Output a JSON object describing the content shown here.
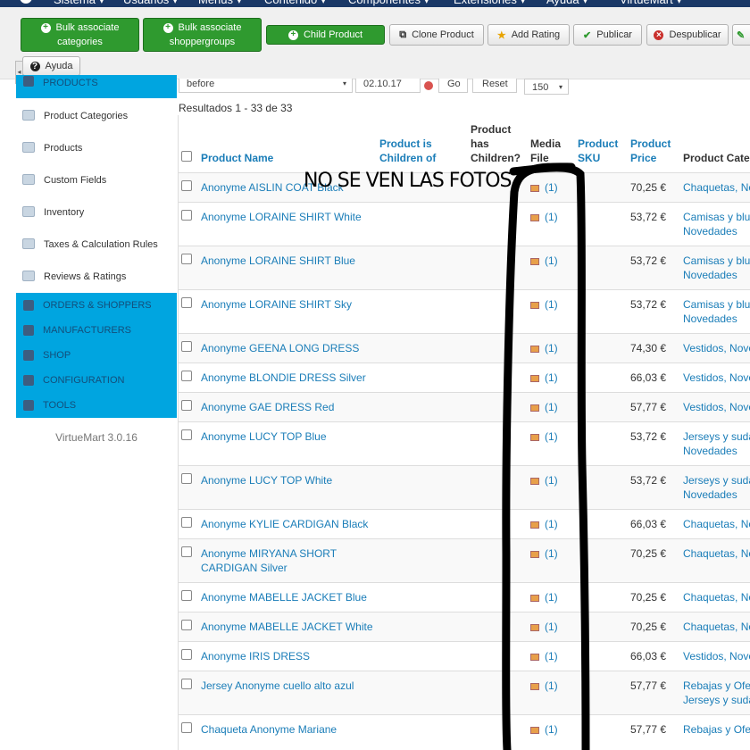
{
  "top_menu": [
    "Sistema ▾",
    "Usuarios ▾",
    "Menús ▾",
    "Contenido ▾",
    "Componentes ▾",
    "Extensiones ▾",
    "Ayuda ▾",
    "VirtueMart ▾"
  ],
  "toolbar": {
    "bulk_categories": [
      "Bulk associate",
      "categories"
    ],
    "bulk_shoppergroups": [
      "Bulk associate",
      "shoppergroups"
    ],
    "child_product": "Child Product",
    "clone_product": "Clone Product",
    "add_rating": "Add Rating",
    "publicar": "Publicar",
    "despublicar": "Despublicar",
    "help": "Ayuda"
  },
  "sidebar": {
    "products_header": "PRODUCTS",
    "items": [
      "Product Categories",
      "Products",
      "Custom Fields",
      "Inventory",
      "Taxes & Calculation Rules",
      "Reviews & Ratings"
    ],
    "sections": [
      "ORDERS & SHOPPERS",
      "MANUFACTURERS",
      "SHOP",
      "CONFIGURATION",
      "TOOLS"
    ],
    "version": "VirtueMart 3.0.16"
  },
  "filters": {
    "when": "before",
    "date": "02.10.17",
    "go": "Go",
    "reset": "Reset",
    "limit": "150"
  },
  "results_text": "Resultados 1 - 33 de 33",
  "columns": [
    "Product Name",
    "Product is Children of",
    "Product has Children?",
    "Media File",
    "Product SKU",
    "Product Price",
    "Product Categ"
  ],
  "rows": [
    {
      "name": "Anonyme AISLIN COAT Black",
      "media": "(1)",
      "price": "70,25 €",
      "cat": [
        "Chaquetas, No"
      ]
    },
    {
      "name": "Anonyme LORAINE SHIRT White",
      "media": "(1)",
      "price": "53,72 €",
      "cat": [
        "Camisas y blu",
        "Novedades"
      ]
    },
    {
      "name": "Anonyme LORAINE SHIRT Blue",
      "media": "(1)",
      "price": "53,72 €",
      "cat": [
        "Camisas y blu",
        "Novedades"
      ]
    },
    {
      "name": "Anonyme LORAINE SHIRT Sky",
      "media": "(1)",
      "price": "53,72 €",
      "cat": [
        "Camisas y blu",
        "Novedades"
      ]
    },
    {
      "name": "Anonyme GEENA LONG DRESS",
      "media": "(1)",
      "price": "74,30 €",
      "cat": [
        "Vestidos, Nove"
      ]
    },
    {
      "name": "Anonyme BLONDIE DRESS Silver",
      "media": "(1)",
      "price": "66,03 €",
      "cat": [
        "Vestidos, Nove"
      ]
    },
    {
      "name": "Anonyme GAE DRESS Red",
      "media": "(1)",
      "price": "57,77 €",
      "cat": [
        "Vestidos, Nove"
      ]
    },
    {
      "name": "Anonyme LUCY TOP Blue",
      "media": "(1)",
      "price": "53,72 €",
      "cat": [
        "Jerseys y suda",
        "Novedades"
      ]
    },
    {
      "name": "Anonyme LUCY TOP White",
      "media": "(1)",
      "price": "53,72 €",
      "cat": [
        "Jerseys y suda",
        "Novedades"
      ]
    },
    {
      "name": "Anonyme KYLIE CARDIGAN Black",
      "media": "(1)",
      "price": "66,03 €",
      "cat": [
        "Chaquetas, No"
      ]
    },
    {
      "name": "Anonyme MIRYANA SHORT CARDIGAN Silver",
      "media": "(1)",
      "price": "70,25 €",
      "cat": [
        "Chaquetas, No"
      ]
    },
    {
      "name": "Anonyme MABELLE JACKET Blue",
      "media": "(1)",
      "price": "70,25 €",
      "cat": [
        "Chaquetas, No"
      ]
    },
    {
      "name": "Anonyme MABELLE JACKET White",
      "media": "(1)",
      "price": "70,25 €",
      "cat": [
        "Chaquetas, No"
      ]
    },
    {
      "name": "Anonyme IRIS DRESS",
      "media": "(1)",
      "price": "66,03 €",
      "cat": [
        "Vestidos, Nove"
      ]
    },
    {
      "name": "Jersey Anonyme cuello alto azul",
      "media": "(1)",
      "price": "57,77 €",
      "cat": [
        "Rebajas y Ofe",
        "Jerseys y suda"
      ]
    },
    {
      "name": "Chaqueta Anonyme Mariane",
      "media": "(1)",
      "price": "57,77 €",
      "cat": [
        "Rebajas y Ofe"
      ]
    }
  ],
  "annotation": "NO SE VEN LAS FOTOS"
}
